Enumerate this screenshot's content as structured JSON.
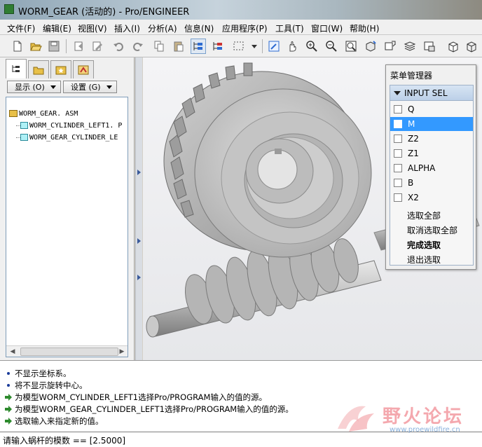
{
  "window": {
    "title": "WORM_GEAR (活动的) - Pro/ENGINEER"
  },
  "menubar": {
    "items": [
      "文件(F)",
      "编辑(E)",
      "视图(V)",
      "插入(I)",
      "分析(A)",
      "信息(N)",
      "应用程序(P)",
      "工具(T)",
      "窗口(W)",
      "帮助(H)"
    ]
  },
  "toolbar": {
    "icons": [
      "new-icon",
      "open-icon",
      "save-icon",
      "regenerate-icon",
      "regenerate-manager-icon",
      "undo-icon",
      "redo-icon",
      "copy-icon",
      "paste-icon",
      "model-tree-icon",
      "layer-tree-icon",
      "select-box-icon",
      "repaint-icon",
      "spin-center-icon",
      "zoom-in-icon",
      "zoom-out-icon",
      "refit-icon",
      "reorient-icon",
      "saved-views-icon",
      "layers-icon",
      "view-manager-icon",
      "display-style-icon"
    ]
  },
  "left_panel": {
    "tabs": [
      "model-tree-tab",
      "folder-browser-tab",
      "favorites-tab",
      "connections-tab"
    ],
    "show_button": "显示 (O)",
    "settings_button": "设置 (G)",
    "tree": {
      "root": "WORM_GEAR. ASM",
      "children": [
        "WORM_CYLINDER_LEFT1. P",
        "WORM_GEAR_CYLINDER_LE"
      ]
    }
  },
  "menu_manager": {
    "title": "菜单管理器",
    "header": "INPUT SEL",
    "options": [
      {
        "label": "Q",
        "checked": false,
        "selected": false
      },
      {
        "label": "M",
        "checked": false,
        "selected": true
      },
      {
        "label": "Z2",
        "checked": false,
        "selected": false
      },
      {
        "label": "Z1",
        "checked": false,
        "selected": false
      },
      {
        "label": "ALPHA",
        "checked": false,
        "selected": false
      },
      {
        "label": "B",
        "checked": false,
        "selected": false
      },
      {
        "label": "X2",
        "checked": false,
        "selected": false
      }
    ],
    "actions": [
      {
        "label": "选取全部",
        "bold": false
      },
      {
        "label": "取消选取全部",
        "bold": false
      },
      {
        "label": "完成选取",
        "bold": true
      },
      {
        "label": "退出选取",
        "bold": false
      }
    ]
  },
  "messages": [
    {
      "type": "info",
      "text": "不显示坐标系。"
    },
    {
      "type": "info",
      "text": "将不显示旋转中心。"
    },
    {
      "type": "prompt",
      "text": "为模型WORM_CYLINDER_LEFT1选择Pro/PROGRAM输入的值的源。"
    },
    {
      "type": "prompt",
      "text": "为模型WORM_GEAR_CYLINDER_LEFT1选择Pro/PROGRAM输入的值的源。"
    },
    {
      "type": "prompt",
      "text": "选取输入来指定新的值。"
    }
  ],
  "status": {
    "prompt": "请输入蜗杆的模数 == [2.5000]"
  },
  "watermark": {
    "text": "野火论坛",
    "url": "www.proewildfire.cn"
  },
  "colors": {
    "selection": "#3399ff",
    "menu_header": "#c8d8ee",
    "prompt_arrow": "#2d8a2d"
  }
}
